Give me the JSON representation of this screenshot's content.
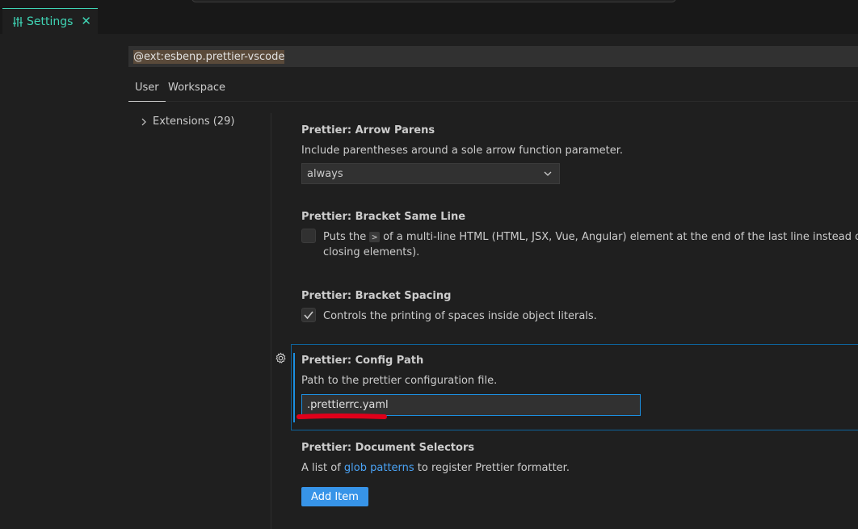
{
  "tab": {
    "label": "Settings",
    "close": "✕"
  },
  "search": {
    "value": "@ext:esbenp.prettier-vscode"
  },
  "scope_tabs": {
    "user": "User",
    "workspace": "Workspace"
  },
  "tree": {
    "extensions_label": "Extensions (29)"
  },
  "settings": {
    "arrow_parens": {
      "title": "Prettier: Arrow Parens",
      "description": "Include parentheses around a sole arrow function parameter.",
      "value": "always"
    },
    "bracket_same_line": {
      "title": "Prettier: Bracket Same Line",
      "desc_before": "Puts the ",
      "desc_code": ">",
      "desc_after": " of a multi-line HTML (HTML, JSX, Vue, Angular) element at the end of the last line instead of being alone on the next line (does not apply to self",
      "desc_line2": "closing elements).",
      "checked": false
    },
    "bracket_spacing": {
      "title": "Prettier: Bracket Spacing",
      "description": "Controls the printing of spaces inside object literals.",
      "checked": true
    },
    "config_path": {
      "title": "Prettier: Config Path",
      "description": "Path to the prettier configuration file.",
      "value": ".prettierrc.yaml"
    },
    "document_selectors": {
      "title": "Prettier: Document Selectors",
      "desc_before": "A list of ",
      "desc_link": "glob patterns",
      "desc_after": " to register Prettier formatter.",
      "button": "Add Item"
    }
  },
  "colors": {
    "accent": "#3fd4b4",
    "focus": "#1c8fe0",
    "button": "#3794e8",
    "annotation": "#e0001a"
  }
}
